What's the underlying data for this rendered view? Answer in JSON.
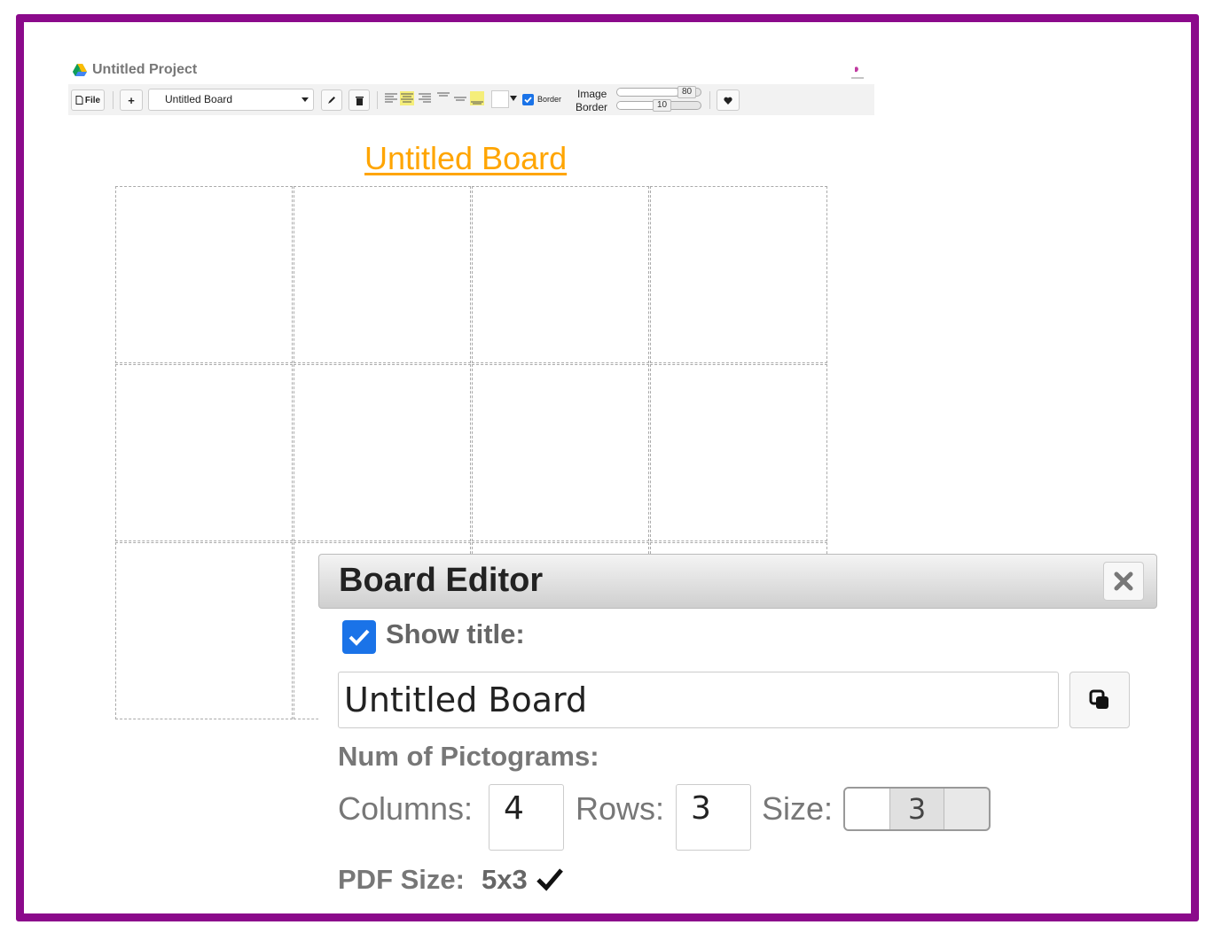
{
  "project": {
    "title": "Untitled Project"
  },
  "toolbar": {
    "file_label": "File",
    "add_label": "+",
    "board_select": "Untitled Board",
    "border_label": "Border",
    "image_label": "Image",
    "border_slider_label": "Border",
    "image_value": "80",
    "border_value": "10",
    "image_fraction": 0.72,
    "border_fraction": 0.45
  },
  "board": {
    "title": "Untitled Board",
    "columns": 4,
    "rows": 3
  },
  "dialog": {
    "title": "Board Editor",
    "show_title_label": "Show title:",
    "title_value": "Untitled Board",
    "num_label": "Num of Pictograms:",
    "columns_label": "Columns:",
    "columns_value": "4",
    "rows_label": "Rows:",
    "rows_value": "3",
    "size_label": "Size:",
    "size_value": "3",
    "pdf_label": "PDF Size:",
    "pdf_value": "5x3"
  },
  "colors": {
    "frame": "#8b0a8b",
    "title": "#ffa500",
    "accent": "#1a73e8"
  },
  "icons": [
    "drive-icon",
    "logo-icon",
    "file-icon",
    "pencil-icon",
    "trash-icon",
    "align-left-icon",
    "align-center-icon",
    "align-right-icon",
    "align-top-icon",
    "align-middle-icon",
    "align-bottom-icon",
    "heart-icon",
    "close-icon",
    "copy-icon",
    "checkmark-icon"
  ]
}
